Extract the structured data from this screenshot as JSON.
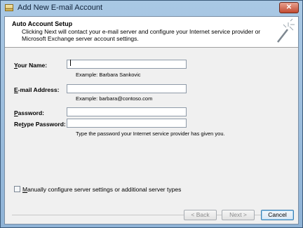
{
  "window": {
    "title": "Add New E-mail Account",
    "close_glyph": "✕"
  },
  "header": {
    "title": "Auto Account Setup",
    "description": "Clicking Next will contact your e-mail server and configure your Internet service provider or Microsoft Exchange server account settings."
  },
  "form": {
    "name": {
      "label_prefix": "Y",
      "label_rest": "our Name:",
      "value": "",
      "example": "Example: Barbara Sankovic"
    },
    "email": {
      "label_prefix": "E",
      "label_rest": "-mail Address:",
      "value": "",
      "example": "Example: barbara@contoso.com"
    },
    "password": {
      "label_prefix": "P",
      "label_rest": "assword:",
      "value": ""
    },
    "retype": {
      "label_pre": "Re",
      "label_ul": "t",
      "label_post": "ype Password:",
      "value": "",
      "hint": "Type the password your Internet service provider has given you."
    }
  },
  "manual": {
    "checked": false,
    "label_prefix": "M",
    "label_rest": "anually configure server settings or additional server types"
  },
  "buttons": {
    "back": "< Back",
    "next": "Next >",
    "cancel": "Cancel"
  },
  "icons": {
    "app": "mail-account-icon",
    "wizard": "magic-wand-icon"
  }
}
